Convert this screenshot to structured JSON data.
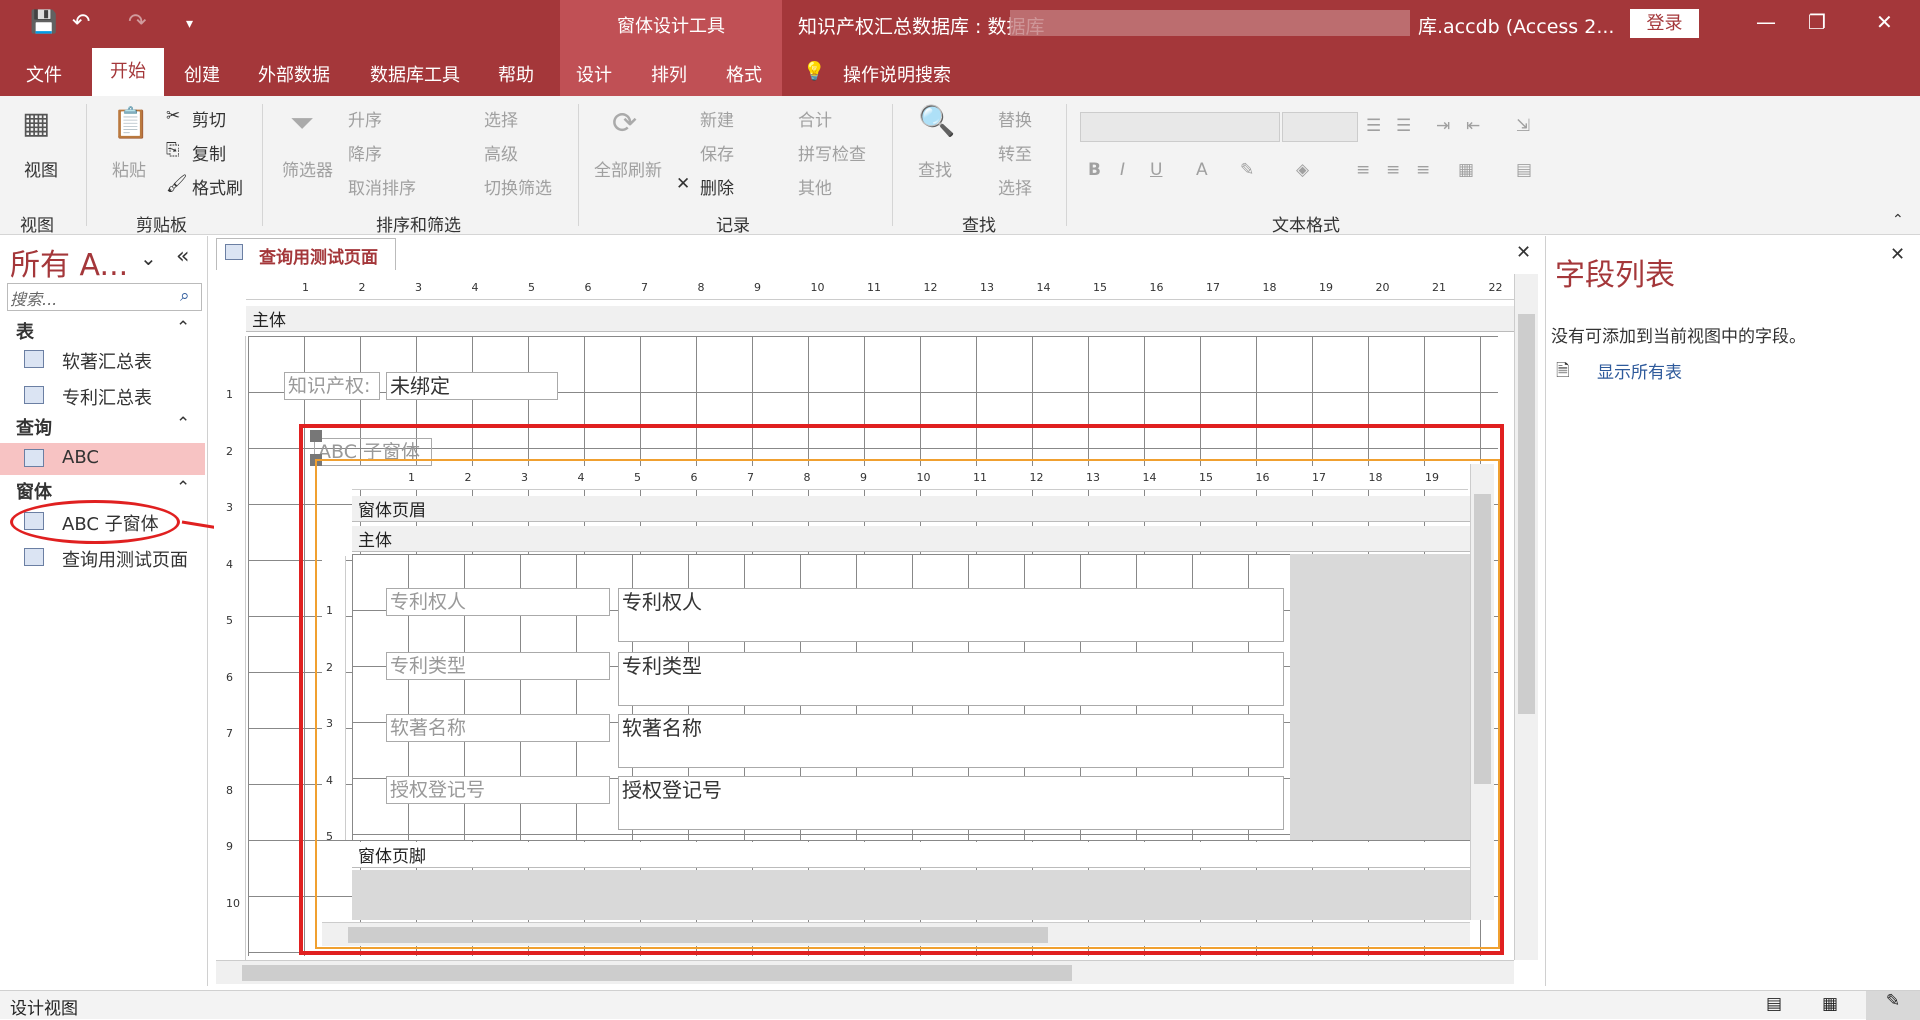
{
  "title_bar": {
    "contextual_group": "窗体设计工具",
    "window_title": "知识产权汇总数据库 : 数据库",
    "window_title_tail": "库.accdb (Access 2...",
    "login": "登录"
  },
  "tabs": [
    "文件",
    "开始",
    "创建",
    "外部数据",
    "数据库工具",
    "帮助",
    "设计",
    "排列",
    "格式"
  ],
  "active_tab": "开始",
  "tell_me": "操作说明搜索",
  "ribbon": {
    "view": {
      "button": "视图",
      "group": "视图"
    },
    "clipboard": {
      "paste": "粘贴",
      "cut": "剪切",
      "copy": "复制",
      "format_painter": "格式刷",
      "group": "剪贴板"
    },
    "sort_filter": {
      "filter": "筛选器",
      "asc": "升序",
      "desc": "降序",
      "remove_sort": "取消排序",
      "selection": "选择",
      "advanced": "高级",
      "toggle_filter": "切换筛选",
      "group": "排序和筛选"
    },
    "records": {
      "refresh_all": "全部刷新",
      "new": "新建",
      "save": "保存",
      "delete": "删除",
      "totals": "合计",
      "spelling": "拼写检查",
      "more": "其他",
      "group": "记录"
    },
    "find": {
      "find": "查找",
      "replace": "替换",
      "goto": "转至",
      "select": "选择",
      "group": "查找"
    },
    "text_format": {
      "group": "文本格式",
      "bold": "B",
      "italic": "I",
      "underline": "U"
    }
  },
  "nav_pane": {
    "title": "所有 A...",
    "search_placeholder": "搜索...",
    "sections": [
      {
        "name": "表",
        "items": [
          "软著汇总表",
          "专利汇总表"
        ]
      },
      {
        "name": "查询",
        "items": [
          "ABC"
        ]
      },
      {
        "name": "窗体",
        "items": [
          "ABC 子窗体",
          "查询用测试页面"
        ]
      }
    ]
  },
  "document": {
    "tab_title": "查询用测试页面",
    "body_section": "主体",
    "ip_label": "知识产权:",
    "unbound": "未绑定",
    "subform_label": "ABC 子窗体",
    "subform": {
      "header_section": "窗体页眉",
      "body_section": "主体",
      "footer_section": "窗体页脚",
      "fields": [
        {
          "label": "专利权人",
          "value": "专利权人"
        },
        {
          "label": "专利类型",
          "value": "专利类型"
        },
        {
          "label": "软著名称",
          "value": "软著名称"
        },
        {
          "label": "授权登记号",
          "value": "授权登记号"
        }
      ]
    },
    "ruler_marks": [
      "1",
      "2",
      "3",
      "4",
      "5",
      "6",
      "7",
      "8",
      "9",
      "10",
      "11",
      "12",
      "13",
      "14",
      "15",
      "16",
      "17",
      "18",
      "19",
      "20",
      "21",
      "22"
    ],
    "sub_ruler_marks": [
      "1",
      "2",
      "3",
      "4",
      "5",
      "6",
      "7",
      "8",
      "9",
      "10",
      "11",
      "12",
      "13",
      "14",
      "15",
      "16",
      "17",
      "18",
      "19"
    ],
    "vruler_marks": [
      "1",
      "2",
      "3",
      "4",
      "5",
      "6",
      "7",
      "8",
      "9",
      "10"
    ],
    "sub_vruler_marks": [
      "1",
      "2",
      "3",
      "4",
      "5"
    ]
  },
  "field_list": {
    "title": "字段列表",
    "message": "没有可添加到当前视图中的字段。",
    "show_all": "显示所有表"
  },
  "status_bar": {
    "text": "设计视图"
  },
  "colors": {
    "accent": "#a4373a",
    "highlight": "#e02020",
    "subform_border": "#f0a030"
  }
}
